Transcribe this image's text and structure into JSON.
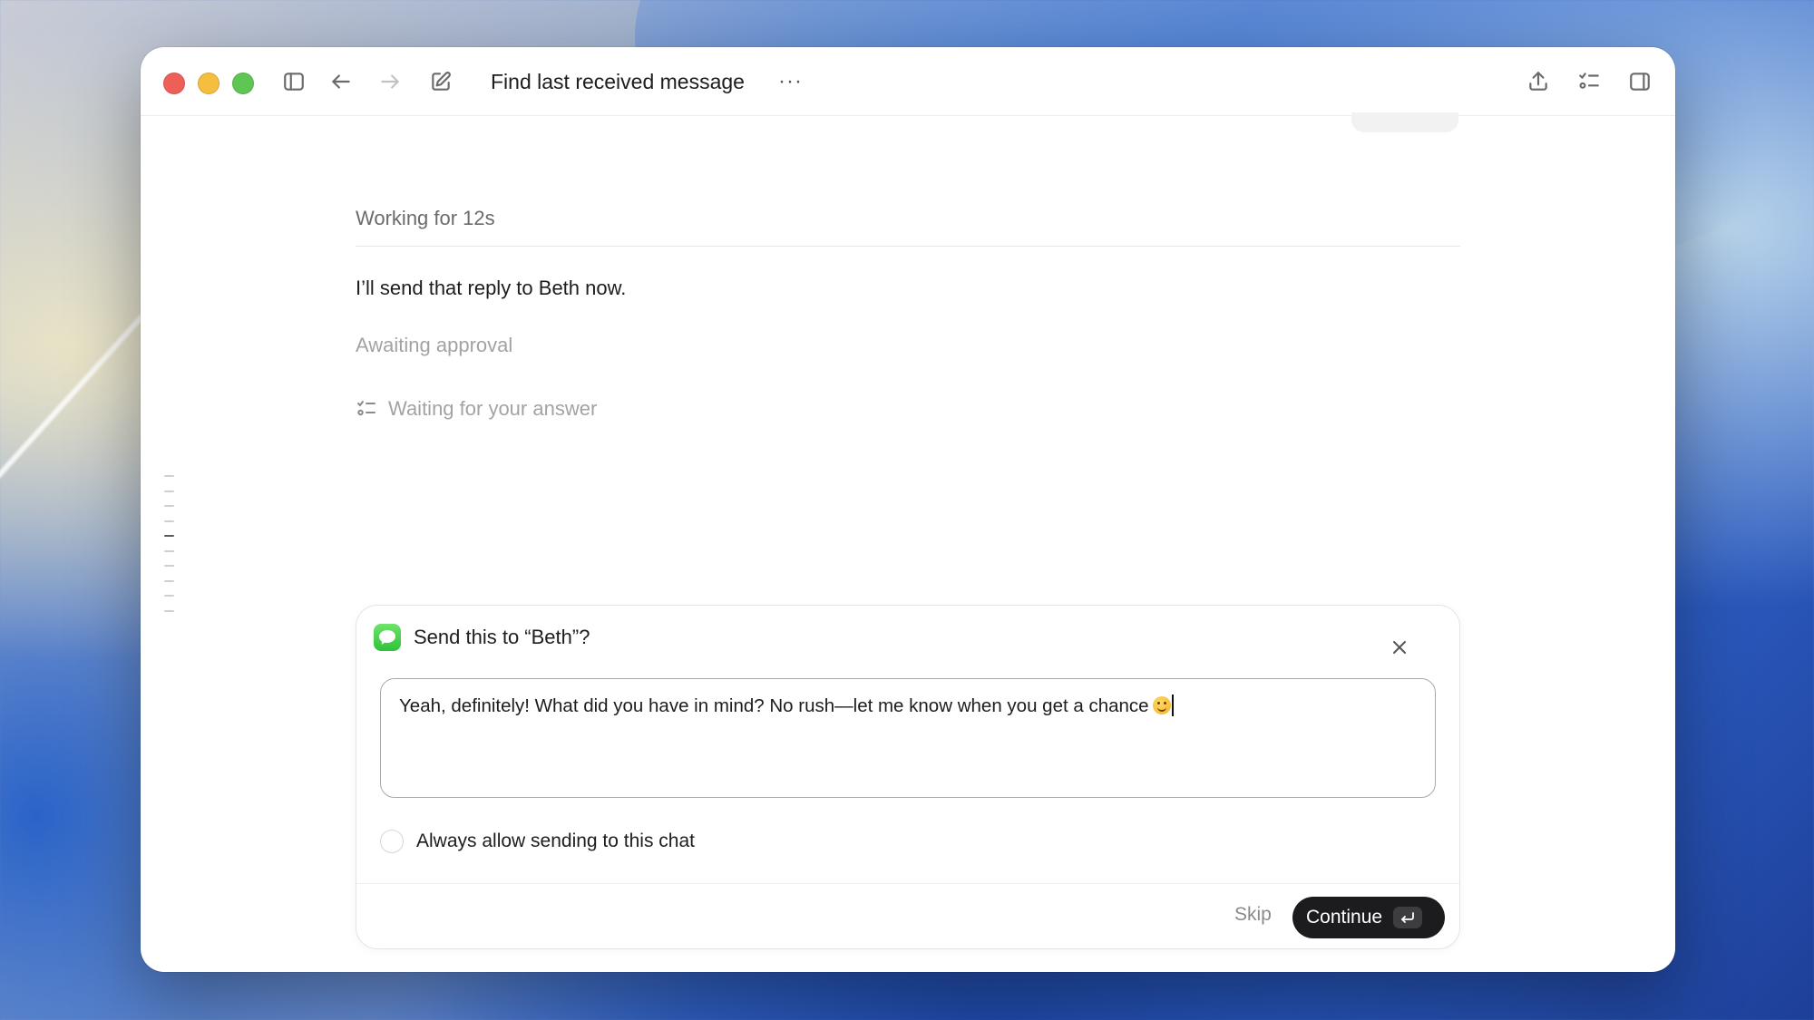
{
  "window": {
    "title": "Find last received message",
    "more_label": "···"
  },
  "transcript": {
    "working_status": "Working for 12s",
    "reply_text": "I’ll send that reply to Beth now.",
    "approval_status": "Awaiting approval",
    "waiting_status": "Waiting for your answer"
  },
  "dialog": {
    "title": "Send this to “Beth”?",
    "message_text": "Yeah, definitely! What did you have in mind? No rush—let me know when you get a chance",
    "always_allow_label": "Always allow sending to this chat",
    "always_allow_checked": false,
    "skip_label": "Skip",
    "continue_label": "Continue"
  },
  "icons": {
    "sidebar": "sidebar-icon",
    "back": "arrow-left-icon",
    "forward": "arrow-right-icon",
    "compose": "compose-icon",
    "share": "share-icon",
    "checklist": "checklist-icon",
    "panel": "panel-icon",
    "messages_app": "messages-app-icon",
    "close": "close-icon",
    "enter": "return-key-icon"
  },
  "colors": {
    "close_dot": "#ee5f57",
    "minimize_dot": "#f5be3f",
    "zoom_dot": "#5fc553",
    "messages_green": "#34c759",
    "continue_bg": "#1c1c1e"
  }
}
